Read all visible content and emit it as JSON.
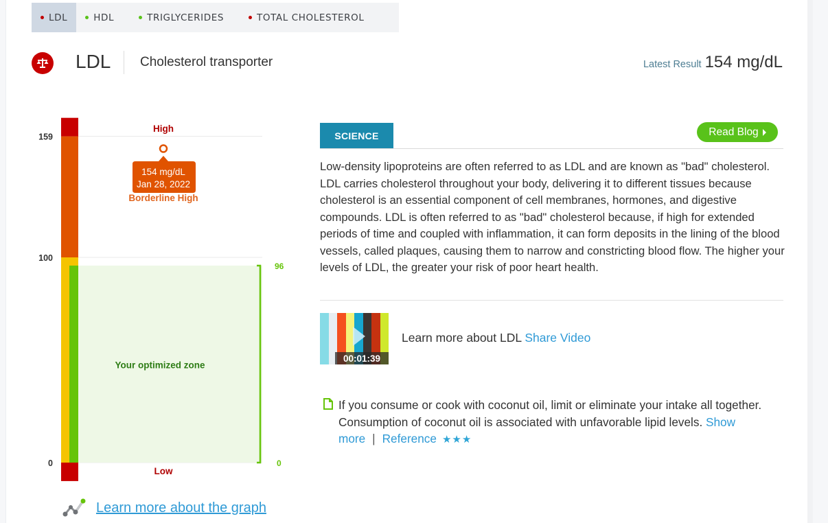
{
  "tabs": [
    {
      "label": "LDL",
      "dot_color": "#c00000",
      "active": true
    },
    {
      "label": "HDL",
      "dot_color": "#59c21a",
      "active": false
    },
    {
      "label": "TRIGLYCERIDES",
      "dot_color": "#59c21a",
      "active": false
    },
    {
      "label": "TOTAL CHOLESTEROL",
      "dot_color": "#c00000",
      "active": false
    }
  ],
  "header": {
    "icon": "scale-balance-icon",
    "title": "LDL",
    "subtitle": "Cholesterol transporter",
    "latest_label": "Latest Result",
    "latest_value": "154 mg/dL"
  },
  "chart_data": {
    "type": "range-gauge",
    "y_ticks": [
      0,
      100,
      159
    ],
    "zones": [
      {
        "name": "Low",
        "from": -9,
        "to": 0,
        "color": "#c80000",
        "label": "Low",
        "label_color": "#b00000"
      },
      {
        "name": "Optimal",
        "from": 0,
        "to": 100,
        "color": "#f5c400"
      },
      {
        "name": "Borderline High",
        "from": 100,
        "to": 159,
        "color": "#e05300",
        "label": "Borderline High",
        "label_color": "#e0651e"
      },
      {
        "name": "High",
        "from": 159,
        "to": 168,
        "color": "#c80000",
        "label": "High",
        "label_color": "#b00000"
      }
    ],
    "optimized_zone": {
      "from": 0,
      "to": 96,
      "label": "Your optimized zone",
      "color": "#66c40a",
      "fill": "#eef8e6",
      "label_color": "#2e7d16",
      "tick_labels": [
        "96",
        "0"
      ]
    },
    "point": {
      "value": 154,
      "unit": "mg/dL",
      "date": "Jan 28, 2022",
      "tooltip_line1": "154 mg/dL",
      "tooltip_line2": "Jan 28, 2022",
      "color": "#e05300"
    }
  },
  "graph_link": {
    "label": "Learn more about the graph",
    "icon": "line-graph-icon"
  },
  "science": {
    "tab_label": "SCIENCE",
    "read_blog_label": "Read Blog",
    "text": "Low-density lipoproteins are often referred to as LDL and are known as \"bad\" cholesterol. LDL carries cholesterol throughout your body, delivering it to different tissues because cholesterol is an essential component of cell membranes, hormones, and digestive compounds. LDL is often referred to as \"bad\" cholesterol because, if high for extended periods of time and coupled with inflammation, it can form deposits in the lining of the blood vessels, called plaques, causing them to narrow and constricting blood flow. The higher your levels of LDL, the greater your risk of poor heart health."
  },
  "video": {
    "duration": "00:01:39",
    "text": "Learn more about LDL",
    "share_label": "Share Video",
    "stripe_colors": [
      "#86dbe6",
      "#e8eef2",
      "#f5501e",
      "#f4f37a",
      "#17a6cf",
      "#3b3431",
      "#c53210",
      "#cfe82c"
    ]
  },
  "tip": {
    "icon": "document-icon",
    "text": "If you consume or cook with coconut oil, limit or eliminate your intake all together. Consumption of coconut oil is associated with unfavorable lipid levels.",
    "show_more": "Show more",
    "separator": "|",
    "reference": "Reference",
    "stars": "★★★",
    "rating": 3
  }
}
